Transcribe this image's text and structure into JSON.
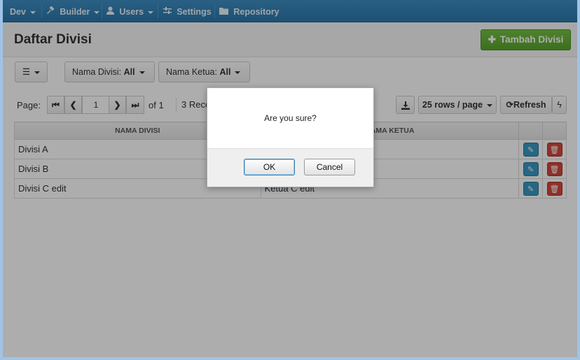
{
  "navbar": {
    "items": [
      {
        "label": "Dev",
        "icon": "",
        "dropdown": true
      },
      {
        "label": "Builder",
        "icon": "hammer-icon",
        "dropdown": true
      },
      {
        "label": "Users",
        "icon": "user-icon",
        "dropdown": true
      },
      {
        "label": "Settings",
        "icon": "sliders-icon",
        "dropdown": false
      },
      {
        "label": "Repository",
        "icon": "folder-icon",
        "dropdown": false
      }
    ]
  },
  "header": {
    "title": "Daftar Divisi",
    "add_button": "Tambah Divisi"
  },
  "filters": {
    "nama_divisi_label": "Nama Divisi:",
    "nama_divisi_value": "All",
    "nama_ketua_label": "Nama Ketua:",
    "nama_ketua_value": "All"
  },
  "pager": {
    "page_label": "Page:",
    "current_page": "1",
    "of_label": "of 1",
    "records_label": "3 Reco",
    "rows_per_page": "25 rows / page",
    "refresh_label": "Refresh"
  },
  "table": {
    "columns": [
      "NAMA DIVISI",
      "NAMA KETUA"
    ],
    "rows": [
      {
        "nama_divisi": "Divisi A",
        "nama_ketua": ""
      },
      {
        "nama_divisi": "Divisi B",
        "nama_ketua": ""
      },
      {
        "nama_divisi": "Divisi C edit",
        "nama_ketua": "Ketua C edit"
      }
    ]
  },
  "dialog": {
    "message": "Are you sure?",
    "ok_label": "OK",
    "cancel_label": "Cancel"
  },
  "colors": {
    "navbar": "#2f80b5",
    "add_button": "#65b236",
    "edit_button": "#3a98c2",
    "delete_button": "#d2473c"
  }
}
